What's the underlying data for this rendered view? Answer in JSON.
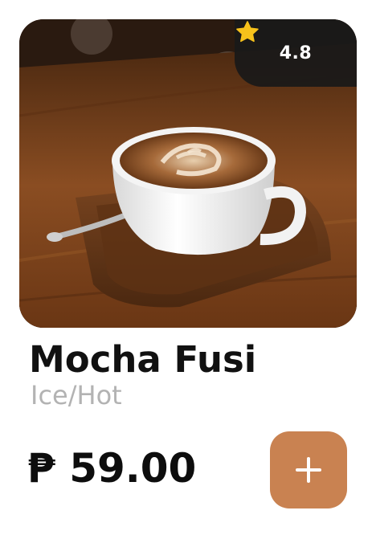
{
  "product": {
    "name": "Mocha Fusi",
    "variant": "Ice/Hot",
    "price": "₱ 59.00",
    "rating": "4.8",
    "image_icon": "coffee-cup-photo"
  },
  "actions": {
    "add_icon": "plus-icon"
  },
  "colors": {
    "accent": "#c98251",
    "rating_bg": "#191919",
    "star": "#f7c21b",
    "subtitle": "#b3b3b3"
  }
}
